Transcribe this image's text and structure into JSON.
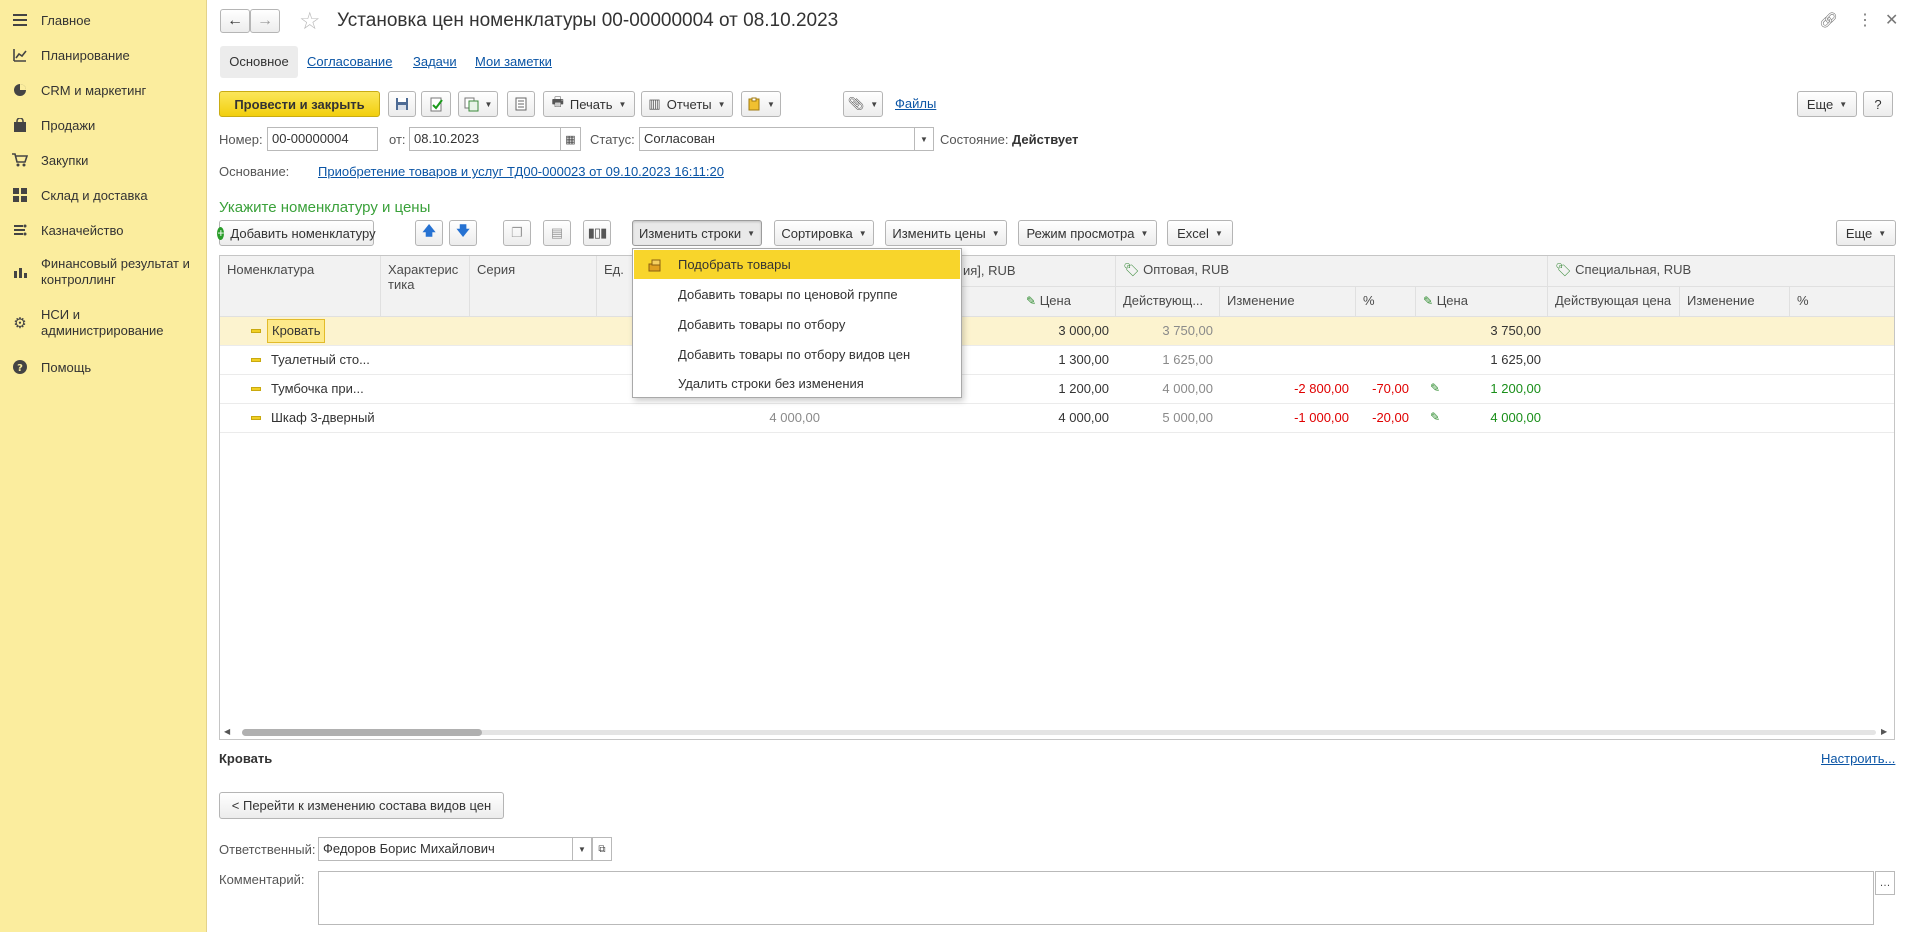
{
  "sidebar": {
    "items": [
      {
        "label": "Главное",
        "icon": "menu-icon"
      },
      {
        "label": "Планирование",
        "icon": "planning-icon"
      },
      {
        "label": "CRM и маркетинг",
        "icon": "pie-chart-icon"
      },
      {
        "label": "Продажи",
        "icon": "shopping-bag-icon"
      },
      {
        "label": "Закупки",
        "icon": "cart-icon"
      },
      {
        "label": "Склад и доставка",
        "icon": "warehouse-icon"
      },
      {
        "label": "Казначейство",
        "icon": "treasury-icon"
      },
      {
        "label": "Финансовый результат и контроллинг",
        "icon": "bar-chart-icon"
      },
      {
        "label": "НСИ и администрирование",
        "icon": "gear-icon"
      },
      {
        "label": "Помощь",
        "icon": "help-icon"
      }
    ]
  },
  "header": {
    "title": "Установка цен номенклатуры 00-00000004 от 08.10.2023"
  },
  "tabs": [
    "Основное",
    "Согласование",
    "Задачи",
    "Мои заметки"
  ],
  "toolbar": {
    "post_close": "Провести и закрыть",
    "print": "Печать",
    "reports": "Отчеты",
    "files": "Файлы",
    "more": "Еще",
    "help": "?"
  },
  "form": {
    "number_label": "Номер:",
    "number": "00-00000004",
    "from_label": "от:",
    "date": "08.10.2023",
    "status_label": "Статус:",
    "status": "Согласован",
    "state_label": "Состояние:",
    "state": "Действует",
    "basis_label": "Основание:",
    "basis_link": "Приобретение товаров и услуг ТД00-000023 от 09.10.2023 16:11:20",
    "section_title": "Укажите номенклатуру и цены"
  },
  "table_toolbar": {
    "add_item": "Добавить номенклатуру",
    "change_rows": "Изменить строки",
    "sort": "Сортировка",
    "change_prices": "Изменить цены",
    "view_mode": "Режим просмотра",
    "excel": "Excel",
    "more": "Еще"
  },
  "menu": {
    "items": [
      "Подобрать товары",
      "Добавить товары по ценовой группе",
      "Добавить товары по отбору",
      "Добавить товары по отбору видов цен",
      "Удалить строки без изменения"
    ]
  },
  "table": {
    "headers": {
      "nomenclature": "Номенклатура",
      "characteristic": "Характеристика",
      "series": "Серия",
      "unit": "Ед.",
      "retail_group": "ия], RUB",
      "wholesale_group": "Оптовая, RUB",
      "special_group": "Специальная, RUB",
      "price": "Цена",
      "current": "Действующ...",
      "change": "Изменение",
      "percent": "%",
      "price2": "Цена",
      "current_price": "Действующая цена",
      "change2": "Изменение",
      "percent2": "%"
    },
    "rows": [
      {
        "name": "Кровать",
        "old": "",
        "price": "3 000,00",
        "wcur": "3 750,00",
        "wchg": "",
        "wpct": "",
        "wprice": "3 750,00"
      },
      {
        "name": "Туалетный сто...",
        "old": "",
        "price": "1 300,00",
        "wcur": "1 625,00",
        "wchg": "",
        "wpct": "",
        "wprice": "1 625,00"
      },
      {
        "name": "Тумбочка при...",
        "old": "",
        "price": "1 200,00",
        "wcur": "4 000,00",
        "wchg": "-2 800,00",
        "wpct": "-70,00",
        "wprice": "1 200,00"
      },
      {
        "name": "Шкаф 3-дверный",
        "old": "4 000,00",
        "price": "4 000,00",
        "wcur": "5 000,00",
        "wchg": "-1 000,00",
        "wpct": "-20,00",
        "wprice": "4 000,00"
      }
    ]
  },
  "footer": {
    "current_item": "Кровать",
    "configure": "Настроить...",
    "goto_button": "< Перейти к изменению состава видов цен",
    "responsible_label": "Ответственный:",
    "responsible": "Федоров Борис Михайлович",
    "comment_label": "Комментарий:",
    "comment": ""
  }
}
